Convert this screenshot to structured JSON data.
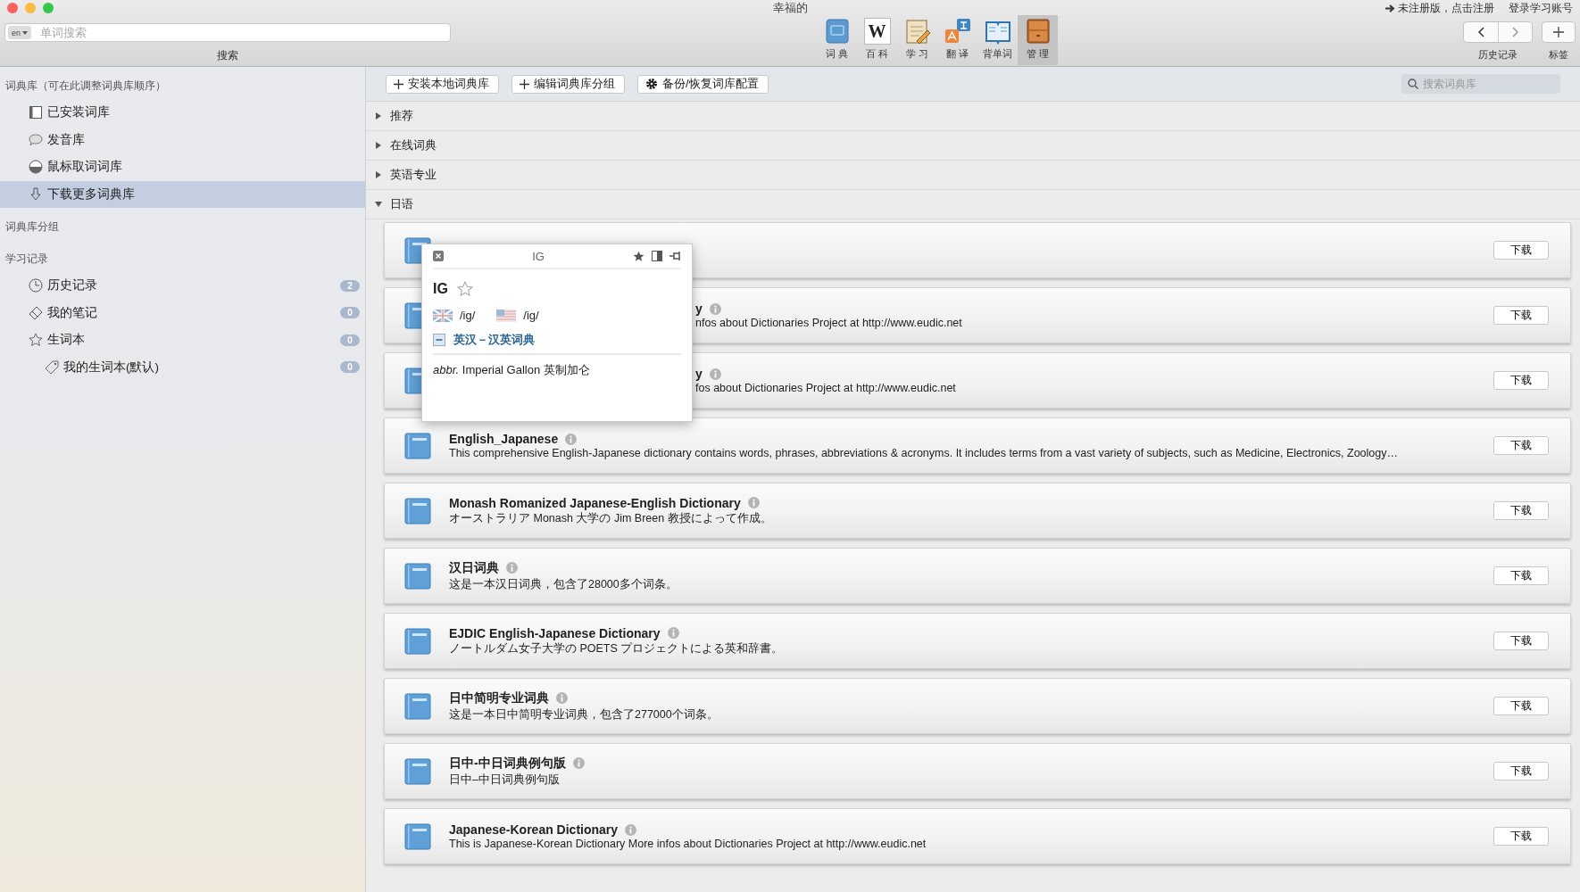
{
  "window": {
    "title": "幸福的"
  },
  "toolbar": {
    "search": {
      "lang_button": "en",
      "placeholder": "单词搜索",
      "label": "搜索"
    },
    "tools": [
      {
        "kind": "dictionary",
        "label": "词 典",
        "selected": false
      },
      {
        "kind": "wiki",
        "glyph": "W",
        "label": "百 科",
        "selected": false
      },
      {
        "kind": "study",
        "label": "学 习",
        "selected": false
      },
      {
        "kind": "translate",
        "label": "翻 译",
        "selected": false
      },
      {
        "kind": "vocab",
        "label": "背单词",
        "selected": false
      },
      {
        "kind": "manage",
        "label": "管 理",
        "selected": true
      }
    ],
    "register_link": "未注册版，点击注册",
    "login_link": "登录学习账号",
    "history_label": "历史记录",
    "bookmark_label": "标签"
  },
  "sidebar": {
    "sections": [
      {
        "title": "词典库（可在此调整词典库顺序）",
        "items": [
          {
            "label": "已安装词库",
            "selected": false
          },
          {
            "label": "发音库",
            "selected": false
          },
          {
            "label": "鼠标取词词库",
            "selected": false
          },
          {
            "label": "下载更多词典库",
            "selected": true
          }
        ]
      },
      {
        "title": "词典库分组"
      },
      {
        "title": "学习记录",
        "items": [
          {
            "label": "历史记录",
            "count": "2",
            "selected": false
          },
          {
            "label": "我的笔记",
            "count": "0",
            "selected": false
          },
          {
            "label": "生词本",
            "count": "0",
            "selected": false,
            "children": [
              {
                "label": "我的生词本(默认)",
                "count": "0",
                "selected": false
              }
            ]
          }
        ]
      }
    ]
  },
  "content": {
    "actions": [
      {
        "label": "安装本地词典库"
      },
      {
        "label": "编辑词典库分组"
      },
      {
        "label": "备份/恢复词库配置"
      }
    ],
    "search": {
      "placeholder": "搜索词典库"
    },
    "categories": [
      {
        "label": "推荐",
        "expanded": false
      },
      {
        "label": "在线词典",
        "expanded": false
      },
      {
        "label": "英语专业",
        "expanded": false
      },
      {
        "label": "日语",
        "expanded": true,
        "dictionaries": [
          {
            "kind": "covered",
            "button": "下载"
          },
          {
            "kind": "covered",
            "title": "y",
            "description": "nfos about  Dictionaries Project at http://www.eudic.net",
            "button": "下载"
          },
          {
            "kind": "covered",
            "title": "y",
            "description": "fos about  Dictionaries Project at http://www.eudic.net",
            "button": "下载"
          },
          {
            "kind": "full",
            "title": "English_Japanese",
            "description": "This comprehensive English-Japanese dictionary contains words, phrases, abbreviations & acronyms. It includes terms from a vast variety of subjects, such as Medicine, Electronics, Zoology…",
            "button": "下载"
          },
          {
            "kind": "full",
            "title": "Monash Romanized Japanese-English Dictionary",
            "description": "オーストラリア Monash 大学の Jim Breen 教授によって作成。",
            "button": "下载"
          },
          {
            "kind": "full",
            "title": "汉日词典",
            "description": "这是一本汉日词典，包含了28000多个词条。",
            "button": "下载"
          },
          {
            "kind": "full",
            "title": "EJDIC English-Japanese Dictionary",
            "description": "ノートルダム女子大学の POETS プロジェクトによる英和辞書。",
            "button": "下载"
          },
          {
            "kind": "full",
            "title": "日中简明专业词典",
            "description": "这是一本日中简明专业词典，包含了277000个词条。",
            "button": "下载"
          },
          {
            "kind": "full",
            "title": "日中-中日词典例句版",
            "description": "日中–中日词典例句版",
            "button": "下载"
          },
          {
            "kind": "full",
            "title": "Japanese-Korean Dictionary",
            "description": "This is  Japanese-Korean Dictionary   More infos about  Dictionaries Project at http://www.eudic.net",
            "button": "下载"
          }
        ]
      }
    ]
  },
  "popup": {
    "title": "IG",
    "word": "IG",
    "favorite": false,
    "pronunciations": [
      {
        "text": "/ig/"
      },
      {
        "text": "/ig/"
      }
    ],
    "dictionary": {
      "name": "英汉－汉英词典",
      "expanded": true
    },
    "definition": "*abbr.* Imperial Gallon 英制加仑"
  }
}
